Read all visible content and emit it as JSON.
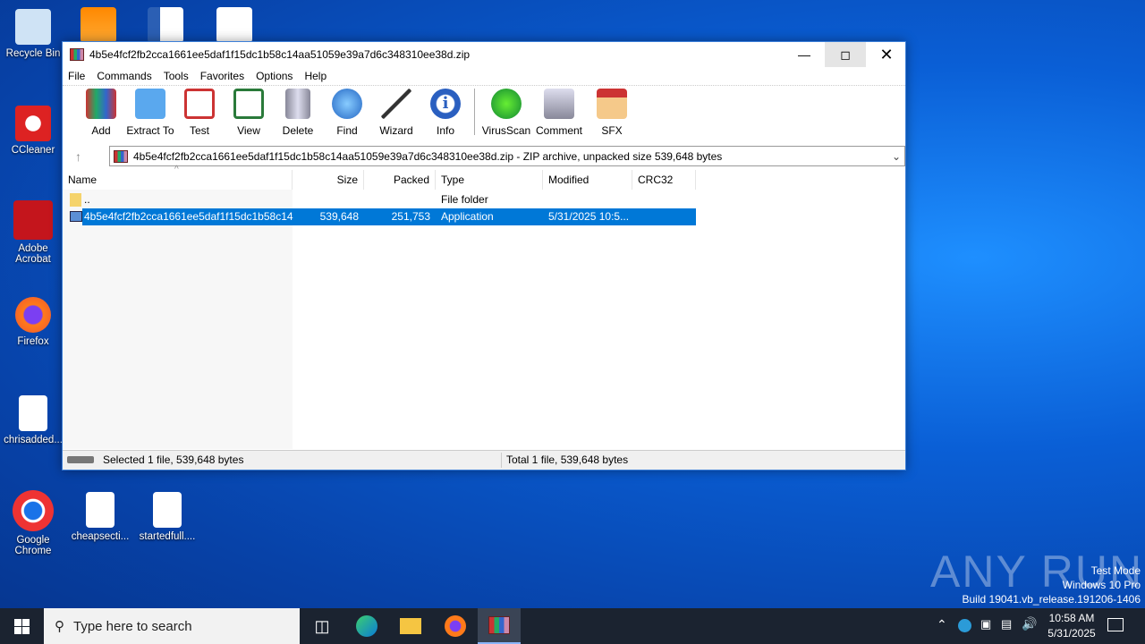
{
  "desktop": {
    "icons": [
      "Recycle Bin",
      "CCleaner",
      "Adobe Acrobat",
      "Firefox",
      "chrisadded...",
      "Google Chrome",
      "cheapsecti...",
      "startedfull...."
    ]
  },
  "window": {
    "title": "4b5e4fcf2fb2cca1661ee5daf1f15dc1b58c14aa51059e39a7d6c348310ee38d.zip",
    "menu": [
      "File",
      "Commands",
      "Tools",
      "Favorites",
      "Options",
      "Help"
    ],
    "toolbar": [
      "Add",
      "Extract To",
      "Test",
      "View",
      "Delete",
      "Find",
      "Wizard",
      "Info",
      "VirusScan",
      "Comment",
      "SFX"
    ],
    "address": "4b5e4fcf2fb2cca1661ee5daf1f15dc1b58c14aa51059e39a7d6c348310ee38d.zip - ZIP archive, unpacked size 539,648 bytes",
    "columns": [
      "Name",
      "Size",
      "Packed",
      "Type",
      "Modified",
      "CRC32"
    ],
    "rows": [
      {
        "name": "..",
        "size": "",
        "packed": "",
        "type": "File folder",
        "modified": ""
      },
      {
        "name": "4b5e4fcf2fb2cca1661ee5daf1f15dc1b58c14...",
        "size": "539,648",
        "packed": "251,753",
        "type": "Application",
        "modified": "5/31/2025 10:5..."
      }
    ],
    "status_left": "Selected 1 file, 539,648 bytes",
    "status_right": "Total 1 file, 539,648 bytes"
  },
  "watermark": {
    "brand": "ANY RUN",
    "line1": "Test Mode",
    "line2": "Windows 10 Pro",
    "line3": "Build 19041.vb_release.191206-1406"
  },
  "taskbar": {
    "search_placeholder": "Type here to search",
    "time": "10:58 AM",
    "date": "5/31/2025"
  },
  "colors": {
    "selection": "#0078d7",
    "taskbar": "#1b2330"
  }
}
